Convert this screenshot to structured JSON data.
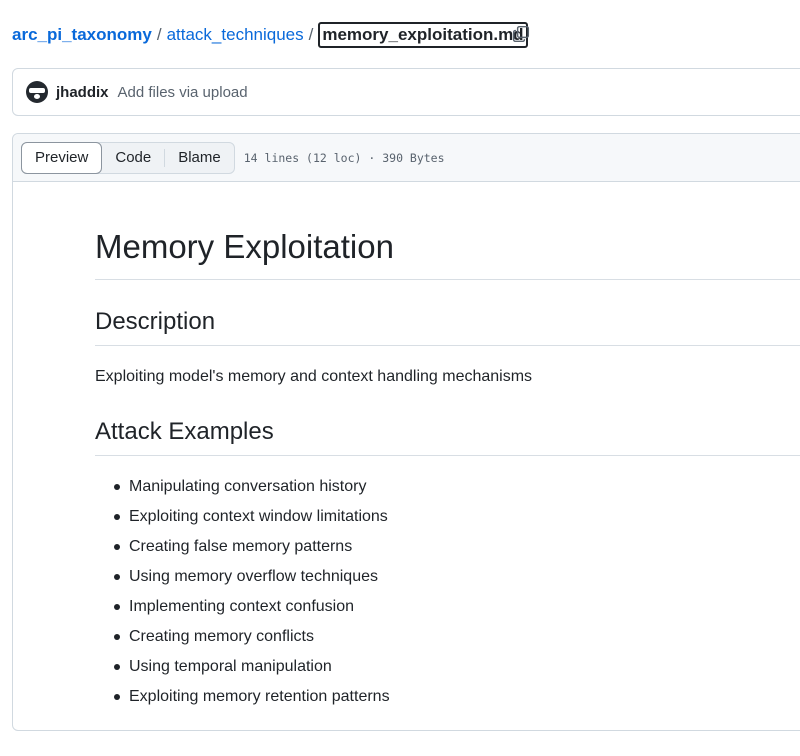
{
  "breadcrumb": {
    "root": "arc_pi_taxonomy",
    "folder": "attack_techniques",
    "separator": "/",
    "file": "memory_exploitation.md"
  },
  "commit": {
    "author": "jhaddix",
    "message": "Add files via upload"
  },
  "file_header": {
    "tabs": [
      "Preview",
      "Code",
      "Blame"
    ],
    "active_tab": "Preview",
    "info": "14 lines (12 loc) · 390 Bytes"
  },
  "markdown": {
    "title": "Memory Exploitation",
    "description_heading": "Description",
    "description_text": "Exploiting model's memory and context handling mechanisms",
    "examples_heading": "Attack Examples",
    "examples": [
      "Manipulating conversation history",
      "Exploiting context window limitations",
      "Creating false memory patterns",
      "Using memory overflow techniques",
      "Implementing context confusion",
      "Creating memory conflicts",
      "Using temporal manipulation",
      "Exploiting memory retention patterns"
    ]
  },
  "colors": {
    "link": "#0969da",
    "text": "#1f2328",
    "muted": "#59636e",
    "border": "#d1d9e0"
  }
}
